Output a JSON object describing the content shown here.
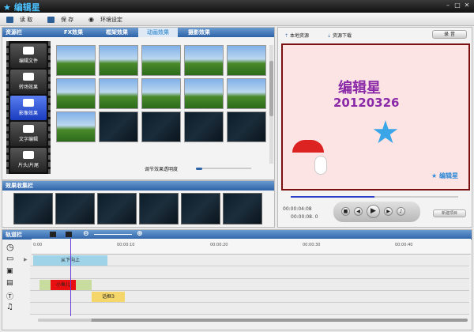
{
  "app": {
    "title": "编辑星"
  },
  "toolbar": {
    "open": "读 取",
    "save": "保 存",
    "settings": "环境设定"
  },
  "resource_panel": {
    "title": "资源栏",
    "tabs": [
      {
        "label": "FX效果"
      },
      {
        "label": "框架效果"
      },
      {
        "label": "动画效果",
        "active": true
      },
      {
        "label": "摄影效果"
      }
    ],
    "sidebar": [
      {
        "label": "编辑文件",
        "icon": "film-icon"
      },
      {
        "label": "转场效果",
        "icon": "transition-icon"
      },
      {
        "label": "影像效果",
        "icon": "image-effect-icon",
        "selected": true
      },
      {
        "label": "文字编辑",
        "icon": "text-icon"
      },
      {
        "label": "片头/片尾",
        "icon": "intro-outro-icon"
      }
    ],
    "opacity_label": "调节效果透明度",
    "opacity_value": 0.1
  },
  "collect_panel": {
    "title": "效果收集栏"
  },
  "right_panel": {
    "local": "本地资源",
    "download": "资源下载",
    "record": "录 音",
    "preview": {
      "title": "编辑星",
      "date": "20120326",
      "logo": "编辑星"
    },
    "time_current": "00:00:04:08",
    "time_total": "00:00:08. 0",
    "progress": 0.5,
    "new_button": "新建项目"
  },
  "timeline": {
    "title": "轨道栏",
    "ruler": [
      "0:00",
      "00:00:10",
      "00:00:20",
      "00:00:30",
      "00:00:40"
    ],
    "clips": [
      {
        "label": "从下向上",
        "color": "#9fd3e8"
      },
      {
        "label": "小鱼儿",
        "color": "#e81010"
      },
      {
        "label": "话框3",
        "color": "#f5d66a"
      }
    ]
  },
  "colors": {
    "accent": "#2e63a8",
    "preview_border": "#7a1010",
    "playhead": "#6a3adc"
  }
}
